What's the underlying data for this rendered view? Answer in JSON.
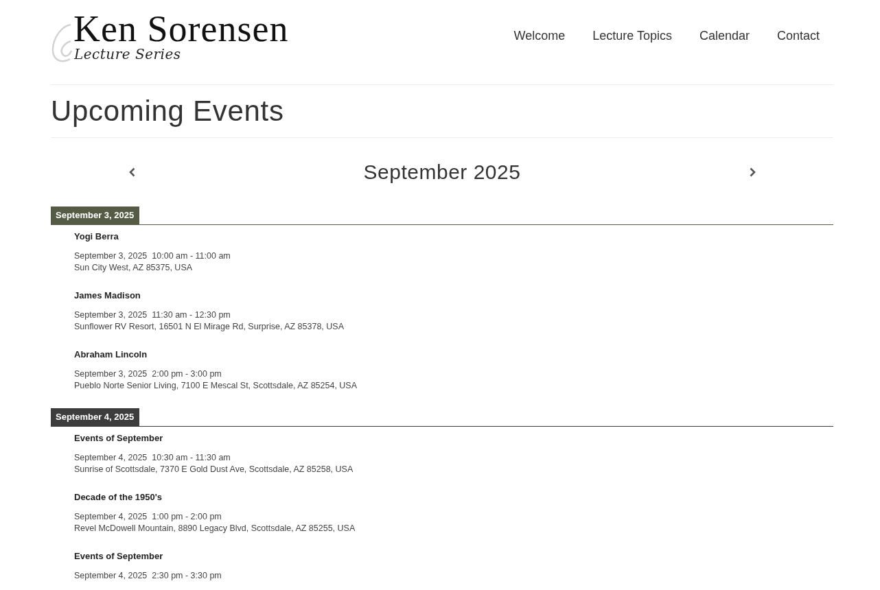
{
  "header": {
    "logo": {
      "title": "Ken Sorensen",
      "subtitle": "Lecture Series"
    },
    "nav": [
      {
        "label": "Welcome"
      },
      {
        "label": "Lecture Topics"
      },
      {
        "label": "Calendar"
      },
      {
        "label": "Contact"
      }
    ]
  },
  "page_title": "Upcoming Events",
  "calendar": {
    "month": "September 2025",
    "days": [
      {
        "date": "September 3, 2025",
        "color": "#565b45",
        "events": [
          {
            "title": "Yogi Berra",
            "date": "September 3, 2025",
            "time": "10:00 am - 11:00 am",
            "address": "Sun City West, AZ 85375, USA"
          },
          {
            "title": "James Madison",
            "date": "September 3, 2025",
            "time": "11:30 am - 12:30 pm",
            "address": "Sunflower RV Resort, 16501 N El Mirage Rd, Surprise, AZ 85378, USA"
          },
          {
            "title": "Abraham Lincoln",
            "date": "September 3, 2025",
            "time": "2:00 pm - 3:00 pm",
            "address": "Pueblo Norte Senior Living, 7100 E Mescal St, Scottsdale, AZ 85254, USA"
          }
        ]
      },
      {
        "date": "September 4, 2025",
        "color": "#3d3d3d",
        "events": [
          {
            "title": "Events of September",
            "date": "September 4, 2025",
            "time": "10:30 am - 11:30 am",
            "address": "Sunrise of Scottsdale, 7370 E Gold Dust Ave, Scottsdale, AZ 85258, USA"
          },
          {
            "title": "Decade of the 1950's",
            "date": "September 4, 2025",
            "time": "1:00 pm - 2:00 pm",
            "address": "Revel McDowell Mountain, 8890 Legacy Blvd, Scottsdale, AZ 85255, USA"
          },
          {
            "title": "Events of September",
            "date": "September 4, 2025",
            "time": "2:30 pm - 3:30 pm"
          }
        ]
      }
    ]
  }
}
